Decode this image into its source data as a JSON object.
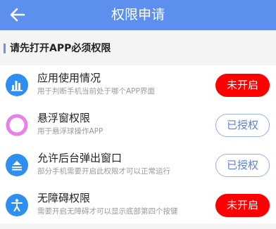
{
  "header": {
    "title": "权限申请",
    "back_icon": "arrow-left-icon"
  },
  "section": {
    "title": "请先打开APP必须权限"
  },
  "colors": {
    "header_bg": "#5d90ee",
    "off_button": "#ff0000",
    "on_button_text": "#5c7ee0"
  },
  "permissions": [
    {
      "title": "应用使用情况",
      "desc": "用于判断手机当前处于哪个APP界面",
      "status": "未开启",
      "icon": "bar-chart-icon",
      "icon_color": "#2f8ff0"
    },
    {
      "title": "悬浮窗权限",
      "desc": "用于悬浮球操作APP",
      "status": "已授权",
      "icon": "floating-ball-icon",
      "icon_color": "#e880e8"
    },
    {
      "title": "允许后台弹出窗口",
      "desc": "部分手机需要开启此权限才可以正常运行",
      "status": "已授权",
      "icon": "popup-window-icon",
      "icon_color": "#2f8ff0"
    },
    {
      "title": "无障碍权限",
      "desc": "需要开启无障碍才可以显示底部第四个按键",
      "status": "未开启",
      "icon": "accessibility-icon",
      "icon_color": "#2f8ff0"
    }
  ]
}
